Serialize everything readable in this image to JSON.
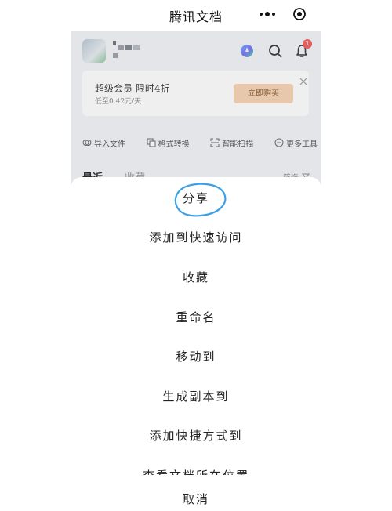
{
  "navbar": {
    "title": "腾讯文档"
  },
  "header": {
    "notification_count": "1"
  },
  "vip_banner": {
    "title": "超级会员 限时4折",
    "subtitle": "低至0.42元/天",
    "buy_label": "立即购买"
  },
  "tools": [
    {
      "label": "导入文件",
      "icon": "import-icon"
    },
    {
      "label": "格式转换",
      "icon": "convert-icon"
    },
    {
      "label": "智能扫描",
      "icon": "scan-icon"
    },
    {
      "label": "更多工具",
      "icon": "more-tools-icon"
    }
  ],
  "tabs": {
    "recent": "最近",
    "favorites": "收藏",
    "filter": "筛选"
  },
  "action_sheet": {
    "items": [
      "分享",
      "添加到快速访问",
      "收藏",
      "重命名",
      "移动到",
      "生成副本到",
      "添加快捷方式到",
      "查看文档所在位置"
    ],
    "cancel": "取消"
  },
  "colors": {
    "highlight_circle": "#3aa0e8",
    "vip_button_bg": "#f6d3b3",
    "badge": "#f35a5a"
  }
}
